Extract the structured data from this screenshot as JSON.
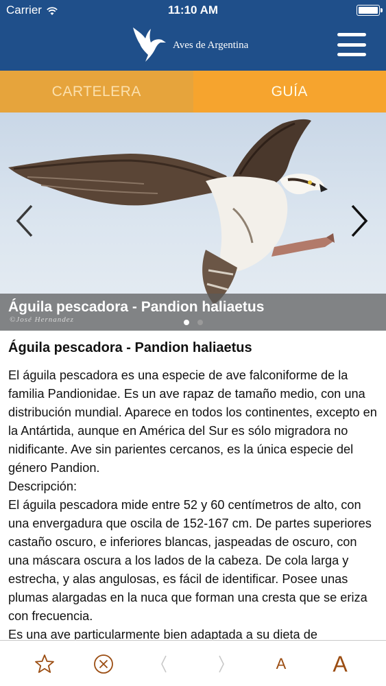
{
  "status_bar": {
    "carrier": "Carrier",
    "time": "11:10 AM",
    "battery_level": 1.0
  },
  "header": {
    "app_title": "Aves de Argentina",
    "logo_icon": "bird-logo-icon",
    "menu_icon": "hamburger-menu-icon"
  },
  "tabs": [
    {
      "label": "CARTELERA",
      "selected": false
    },
    {
      "label": "GUÍA",
      "selected": true
    }
  ],
  "carousel": {
    "caption": "Águila pescadora - Pandion haliaetus",
    "credit": "©José Hernandez",
    "page_count": 2,
    "current_page": 1,
    "prev_icon": "chevron-left-icon",
    "next_icon": "chevron-right-icon"
  },
  "article": {
    "title": "Águila pescadora - Pandion haliaetus",
    "paragraphs": [
      "El águila pescadora es una especie de ave falconiforme de la familia Pandionidae. Es un ave rapaz de tamaño medio, con una distribución mundial. Aparece en todos los continentes, excepto en la Antártida, aunque en América del Sur es sólo migradora no nidificante. Ave sin parientes cercanos, es la única especie del género Pandion.",
      "Descripción:",
      "El águila pescadora mide entre 52 y 60 centímetros de alto, con una envergadura que oscila de 152-167 cm. De partes superiores castaño oscuro, e inferiores blancas, jaspeadas de oscuro, con una máscara oscura a los lados de la cabeza. De cola larga y estrecha, y alas angulosas, es fácil de identificar. Posee unas plumas alargadas en la nuca que forman una cresta que se eriza con frecuencia.",
      "Es una ave particularmente bien adaptada a su dieta de"
    ]
  },
  "toolbar": {
    "favorite_icon": "star-icon",
    "close_icon": "close-circle-icon",
    "previous_icon": "chevron-left-icon",
    "next_icon": "chevron-right-icon",
    "font_smaller_label": "A",
    "font_larger_label": "A"
  },
  "colors": {
    "header": "#1f4f8a",
    "tab_inactive": "#e6a43c",
    "tab_active": "#f6a42e",
    "toolbar_icon": "#9b4d12"
  }
}
